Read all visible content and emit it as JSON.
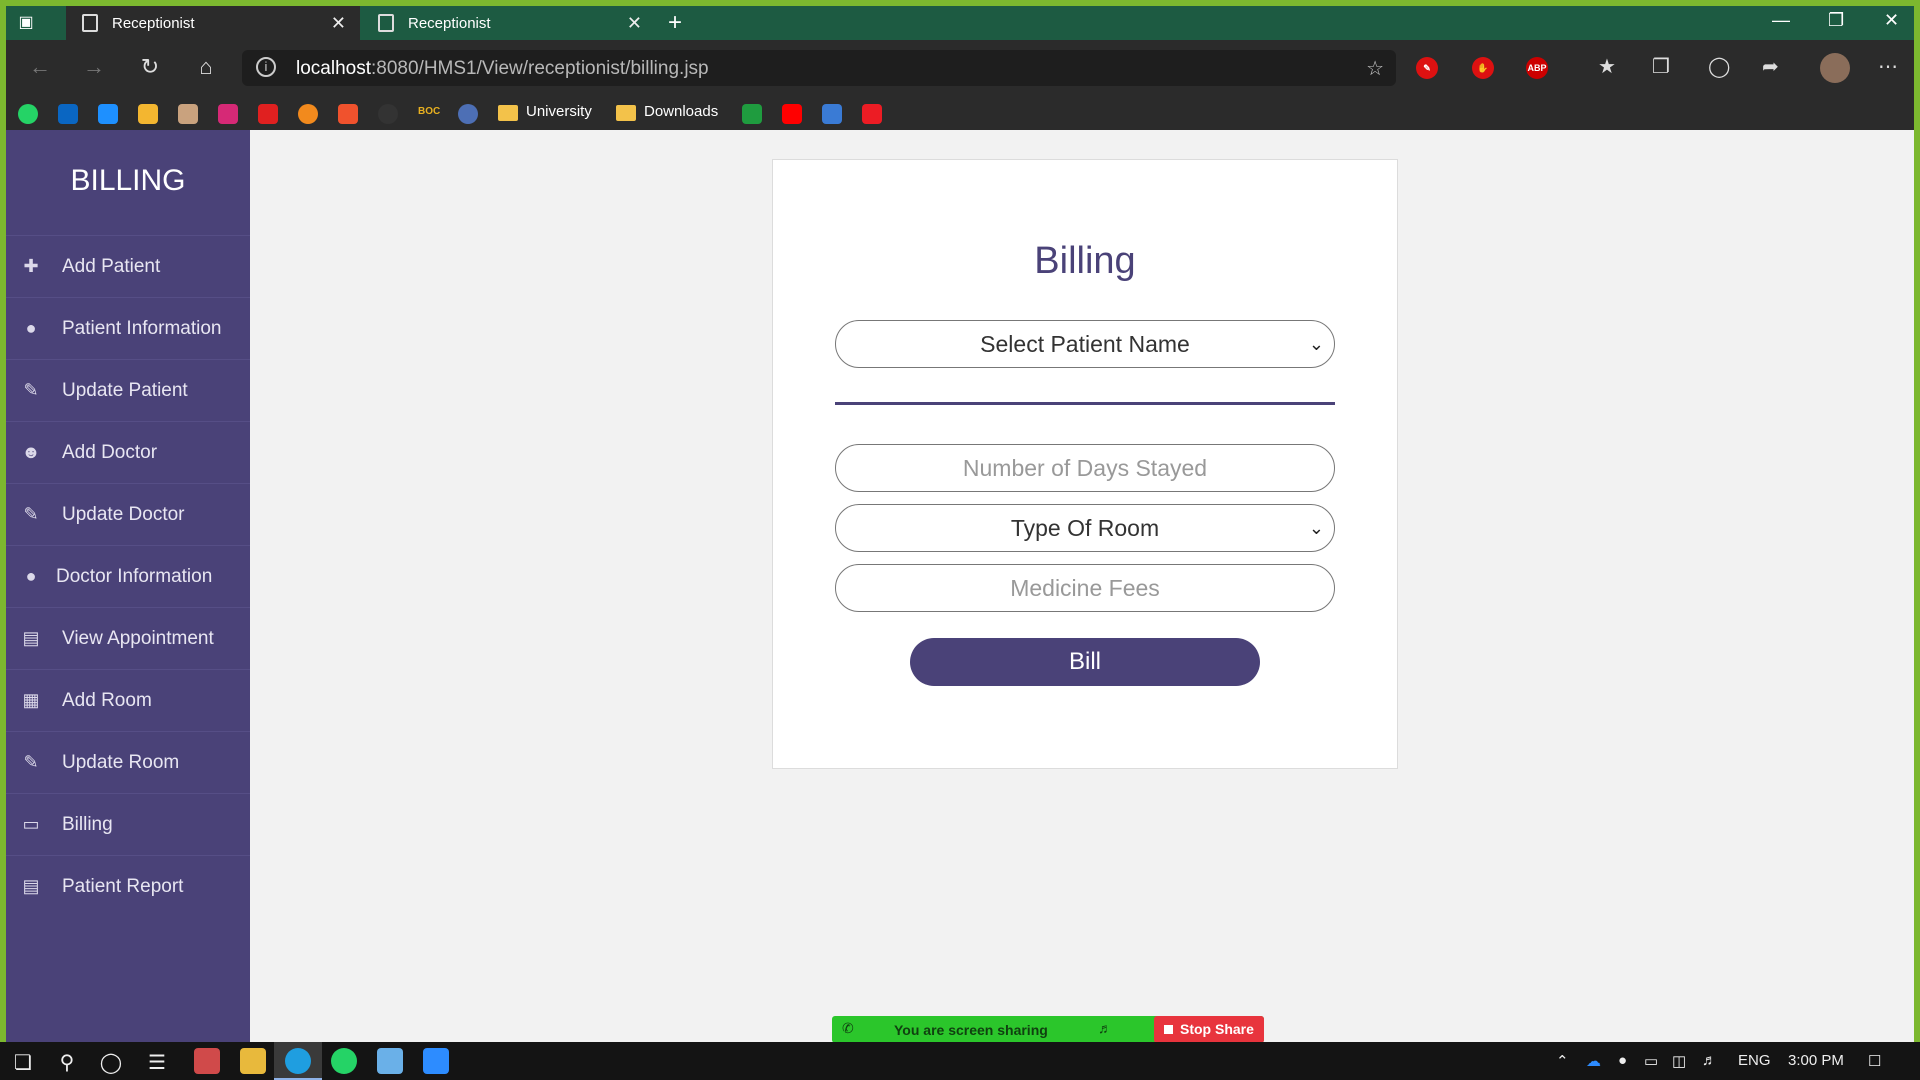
{
  "browser": {
    "tabs": [
      {
        "label": "Receptionist",
        "active": true
      },
      {
        "label": "Receptionist",
        "active": false
      }
    ],
    "new_tab": "+",
    "url_host": "localhost",
    "url_rest": ":8080/HMS1/View/receptionist/billing.jsp",
    "bookmarks": [
      {
        "label": "University"
      },
      {
        "label": "Downloads"
      }
    ],
    "extensions": [
      "ABP"
    ],
    "bookmark_small_text": "BOC"
  },
  "sidebar": {
    "title": "BILLING",
    "items": [
      {
        "label": "Add Patient",
        "icon": "user-plus-icon"
      },
      {
        "label": "Patient Information",
        "icon": "users-icon"
      },
      {
        "label": "Update Patient",
        "icon": "pencil-icon"
      },
      {
        "label": "Add Doctor",
        "icon": "user-icon"
      },
      {
        "label": "Update Doctor",
        "icon": "pencil-icon"
      },
      {
        "label": "Doctor Information",
        "icon": "users-icon"
      },
      {
        "label": "View Appointment",
        "icon": "document-icon"
      },
      {
        "label": "Add Room",
        "icon": "building-icon"
      },
      {
        "label": "Update Room",
        "icon": "pencil-icon"
      },
      {
        "label": "Billing",
        "icon": "money-icon"
      },
      {
        "label": "Patient Report",
        "icon": "document-icon"
      }
    ]
  },
  "form": {
    "title": "Billing",
    "patient_select": "Select Patient Name",
    "days_placeholder": "Number of Days Stayed",
    "room_select": "Type Of Room",
    "medicine_placeholder": "Medicine Fees",
    "submit_label": "Bill"
  },
  "share_bar": {
    "status": "You are screen sharing",
    "stop_label": "Stop Share"
  },
  "taskbar": {
    "language": "ENG",
    "time": "3:00 PM"
  },
  "colors": {
    "sidebar": "#4a4278",
    "accent": "#4a4278",
    "tabbar": "#1d5b42",
    "share_green": "#2bc62b",
    "stop_red": "#e8343d"
  }
}
